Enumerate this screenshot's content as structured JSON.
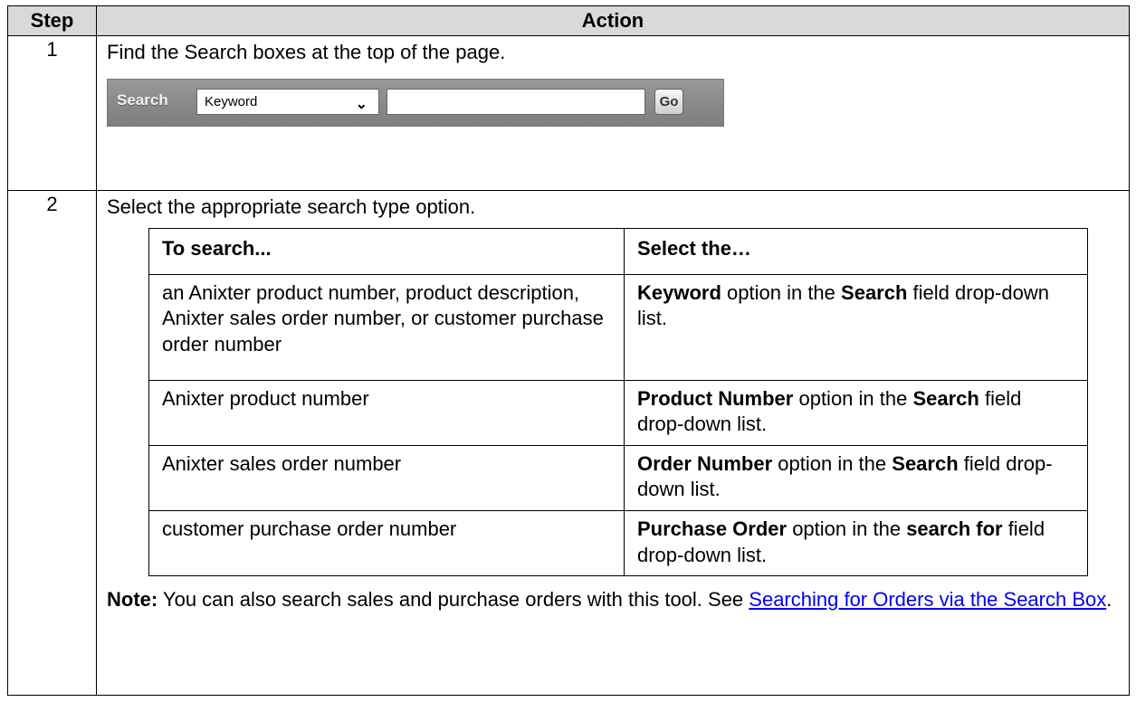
{
  "header": {
    "step": "Step",
    "action": "Action"
  },
  "rows": [
    {
      "step": "1",
      "text": "Find the Search boxes at the top of the page."
    },
    {
      "step": "2",
      "text": "Select the appropriate search type option."
    }
  ],
  "search_bar": {
    "label": "Search",
    "select_value": "Keyword",
    "input_value": "",
    "go_label": "Go"
  },
  "inner_table": {
    "headers": [
      "To search...",
      "Select the…"
    ],
    "rows": [
      {
        "left": "an Anixter product number, product description, Anixter sales order number, or customer purchase order number",
        "bold1": "Keyword",
        "t1": " option in the ",
        "bold2": "Search",
        "t2": " field drop-down list."
      },
      {
        "left": "Anixter product number",
        "bold1": "Product Number",
        "t1": " option in the ",
        "bold2": "Search",
        "t2": " field drop-down list."
      },
      {
        "left": "Anixter sales order number",
        "bold1": "Order Number",
        "t1": " option in the ",
        "bold2": "Search",
        "t2": " field drop-down list."
      },
      {
        "left": "customer purchase order number",
        "bold1": "Purchase Order",
        "t1": " option in the ",
        "bold2": "search for",
        "t2": " field drop-down list."
      }
    ]
  },
  "note": {
    "label": "Note:",
    "text": " You can also search sales and purchase orders with this tool.  See ",
    "link": "Searching for Orders via the Search Box",
    "end": "."
  }
}
